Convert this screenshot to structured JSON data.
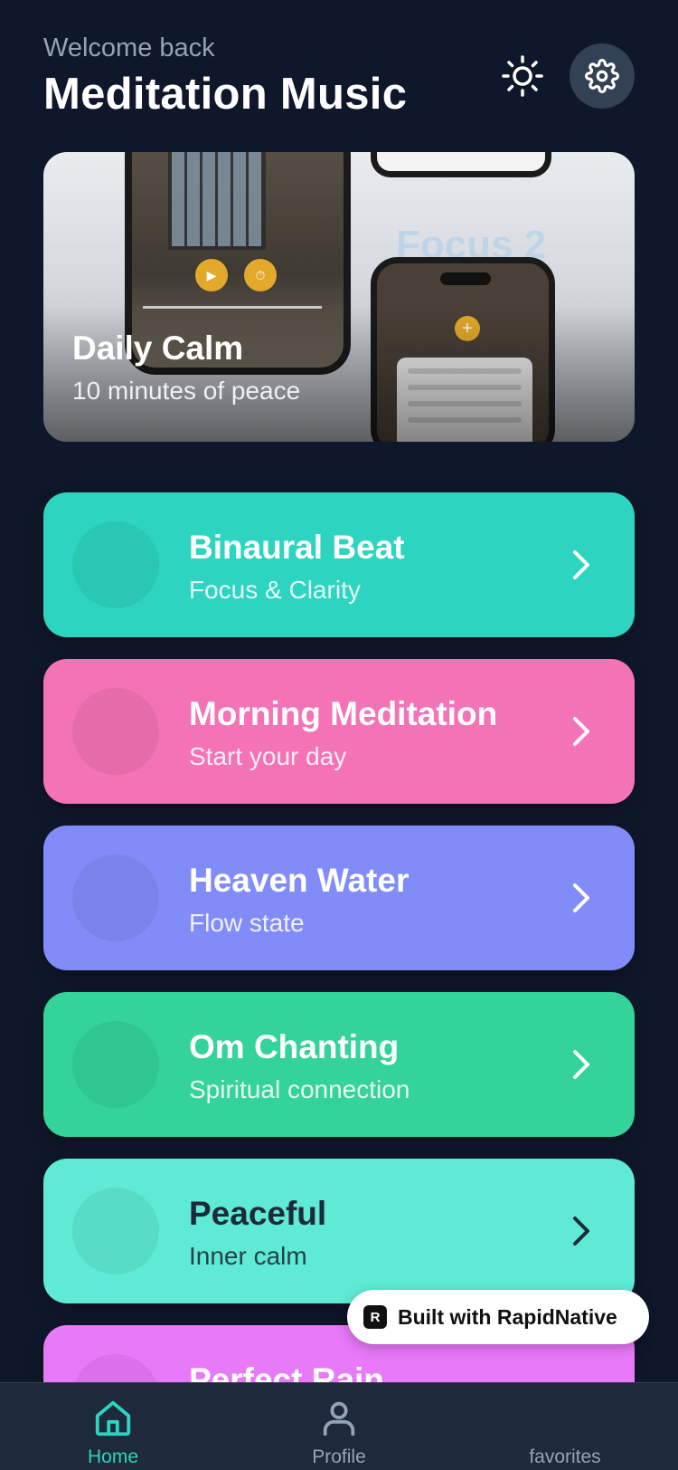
{
  "header": {
    "welcome": "Welcome back",
    "title": "Meditation Music",
    "theme_icon": "sun-icon",
    "settings_icon": "gear-icon"
  },
  "hero": {
    "title": "Daily Calm",
    "subtitle": "10 minutes of peace",
    "bg_text": "Focus 2"
  },
  "categories": [
    {
      "title": "Binaural Beat",
      "subtitle": "Focus & Clarity",
      "color": "#2dd4bf"
    },
    {
      "title": "Morning Meditation",
      "subtitle": "Start your day",
      "color": "#f472b6"
    },
    {
      "title": "Heaven Water",
      "subtitle": "Flow state",
      "color": "#818cf8"
    },
    {
      "title": "Om Chanting",
      "subtitle": "Spiritual connection",
      "color": "#34d399"
    },
    {
      "title": "Peaceful",
      "subtitle": "Inner calm",
      "color": "#5eead4"
    },
    {
      "title": "Perfect Rain",
      "subtitle": "",
      "color": "#e879f9"
    }
  ],
  "badge": {
    "text": "Built with RapidNative",
    "icon": "rapidnative-logo"
  },
  "tabs": [
    {
      "label": "Home",
      "icon": "home-icon",
      "active": true,
      "color": "#2dd4bf"
    },
    {
      "label": "Profile",
      "icon": "user-icon",
      "active": false,
      "color": "#94a3b8"
    },
    {
      "label": "favorites",
      "icon": "heart-icon",
      "active": false,
      "color": "#94a3b8"
    }
  ]
}
